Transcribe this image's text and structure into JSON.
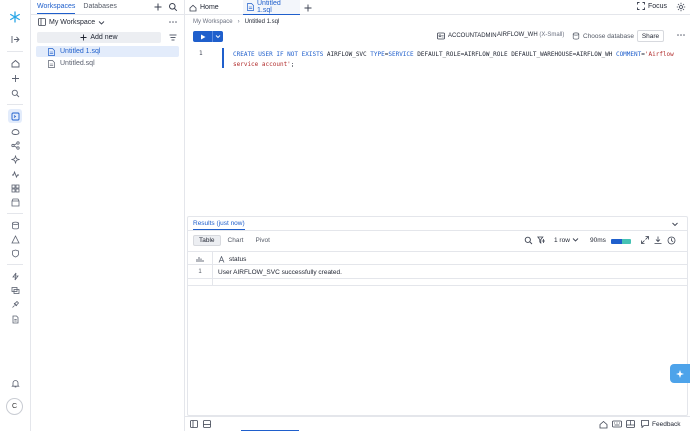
{
  "sidebar": {
    "tabs": [
      {
        "label": "Workspaces",
        "active": true
      },
      {
        "label": "Databases",
        "active": false
      }
    ],
    "workspace_name": "My Workspace",
    "add_new_label": "Add new",
    "files": [
      {
        "name": "Untitled 1.sql",
        "active": true
      },
      {
        "name": "Untitled.sql",
        "active": false
      }
    ]
  },
  "rail": {
    "avatar_initial": "C",
    "icons": [
      "snowflake-logo-icon",
      "collapse-sidebar-icon",
      "home-icon",
      "create-icon",
      "search-icon",
      "worksheets-icon",
      "data-icon",
      "projects-icon",
      "ai-icon",
      "monitoring-icon",
      "apps-icon",
      "marketplace-icon",
      "database-icon",
      "admin-icon",
      "governance-icon",
      "activity-icon",
      "transform-icon",
      "integrations-icon",
      "docs-icon",
      "notifications-icon"
    ]
  },
  "tabs": [
    {
      "label": "Home",
      "icon": "home-icon",
      "active": false
    },
    {
      "label": "Untitled 1.sql",
      "icon": "sql-file-icon",
      "active": true
    }
  ],
  "header": {
    "focus_label": "Focus"
  },
  "breadcrumb": {
    "workspace": "My Workspace",
    "file": "Untitled 1.sql"
  },
  "toolbar": {
    "role": "ACCOUNTADMIN",
    "warehouse": "AIRFLOW_WH",
    "warehouse_size": "(X-Small)",
    "database_placeholder": "Choose database",
    "share_label": "Share"
  },
  "editor": {
    "line_number": "1",
    "tokens": [
      {
        "t": "CREATE USER IF NOT EXISTS",
        "k": "kw"
      },
      {
        "t": " AIRFLOW_SVC ",
        "k": ""
      },
      {
        "t": "TYPE",
        "k": "kw"
      },
      {
        "t": "=",
        "k": ""
      },
      {
        "t": "SERVICE",
        "k": "kw"
      },
      {
        "t": " DEFAULT_ROLE=AIRFLOW_ROLE DEFAULT_WAREHOUSE=AIRFLOW_WH ",
        "k": ""
      },
      {
        "t": "COMMENT",
        "k": "kw"
      },
      {
        "t": "=",
        "k": ""
      },
      {
        "t": "'Airflow service account'",
        "k": "str"
      },
      {
        "t": ";",
        "k": ""
      }
    ]
  },
  "results": {
    "title": "Results (just now)",
    "views": [
      {
        "label": "Table",
        "active": true
      },
      {
        "label": "Chart",
        "active": false
      },
      {
        "label": "Pivot",
        "active": false
      }
    ],
    "row_count": "1 row",
    "duration": "90ms",
    "duration_split": 0.55,
    "column": "status",
    "rows": [
      {
        "index": "1",
        "status": "User AIRFLOW_SVC successfully created."
      }
    ]
  },
  "footer": {
    "feedback_label": "Feedback"
  },
  "colors": {
    "accent": "#1f5fcc",
    "fab": "#4da3ea",
    "selection": "#e3ecfb"
  }
}
